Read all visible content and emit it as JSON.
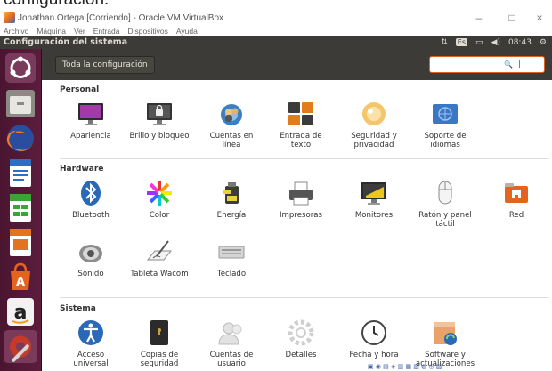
{
  "caption_text": "configuración.",
  "window": {
    "title": "Jonathan.Ortega [Corriendo] - Oracle VM VirtualBox",
    "minimize": "–",
    "maximize": "□",
    "close": "×"
  },
  "vbox_menu": [
    "Archivo",
    "Máquina",
    "Ver",
    "Entrada",
    "Dispositivos",
    "Ayuda"
  ],
  "topbar": {
    "title": "Configuración del sistema",
    "indicators": {
      "network": "⇅",
      "keyboard": "Es",
      "battery": "▭",
      "volume": "◀)",
      "clock": "08:43",
      "power": "⚙"
    }
  },
  "toolbar": {
    "all_settings": "Toda la configuración",
    "search_icon": "🔍",
    "search_text": "|"
  },
  "launcher": [
    "ubuntu-dash",
    "files",
    "firefox",
    "writer",
    "calc",
    "impress",
    "software-center",
    "amazon",
    "system-settings"
  ],
  "sections": [
    {
      "title": "Personal",
      "items": [
        {
          "label": "Apariencia",
          "icon": "appearance-icon"
        },
        {
          "label": "Brillo y bloqueo",
          "icon": "brightness-lock-icon"
        },
        {
          "label": "Cuentas en línea",
          "icon": "online-accounts-icon"
        },
        {
          "label": "Entrada de texto",
          "icon": "text-entry-icon"
        },
        {
          "label": "Seguridad y privacidad",
          "icon": "security-privacy-icon"
        },
        {
          "label": "Soporte de idiomas",
          "icon": "language-support-icon"
        }
      ]
    },
    {
      "title": "Hardware",
      "items": [
        {
          "label": "Bluetooth",
          "icon": "bluetooth-icon"
        },
        {
          "label": "Color",
          "icon": "color-icon"
        },
        {
          "label": "Energía",
          "icon": "power-icon"
        },
        {
          "label": "Impresoras",
          "icon": "printers-icon"
        },
        {
          "label": "Monitores",
          "icon": "monitors-icon"
        },
        {
          "label": "Ratón y panel táctil",
          "icon": "mouse-touchpad-icon"
        },
        {
          "label": "Red",
          "icon": "network-icon"
        },
        {
          "label": "Sonido",
          "icon": "sound-icon"
        },
        {
          "label": "Tableta Wacom",
          "icon": "wacom-tablet-icon"
        },
        {
          "label": "Teclado",
          "icon": "keyboard-icon"
        }
      ]
    },
    {
      "title": "Sistema",
      "items": [
        {
          "label": "Acceso universal",
          "icon": "universal-access-icon"
        },
        {
          "label": "Copias de seguridad",
          "icon": "backups-icon"
        },
        {
          "label": "Cuentas de usuario",
          "icon": "user-accounts-icon"
        },
        {
          "label": "Detalles",
          "icon": "details-icon"
        },
        {
          "label": "Fecha y hora",
          "icon": "date-time-icon"
        },
        {
          "label": "Software y actualizaciones",
          "icon": "software-updates-icon"
        }
      ]
    }
  ],
  "colors": {
    "panel": "#3c3b37",
    "launcher": "#5c1d3c",
    "accent": "#e1601f"
  }
}
